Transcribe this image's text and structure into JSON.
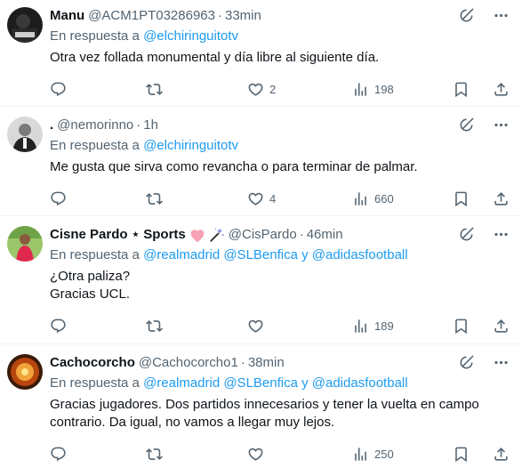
{
  "tweets": [
    {
      "name": "Manu",
      "handle": "@ACM1PT03286963",
      "time": "33min",
      "reply_prefix": "En respuesta a",
      "reply_to": "@elchiringuitotv",
      "text_lines": [
        "Otra vez follada monumental y día libre al siguiente día."
      ],
      "replies": "",
      "retweets": "",
      "likes": "2",
      "views": "198"
    },
    {
      "name": ".",
      "handle": "@nemorinno",
      "time": "1h",
      "reply_prefix": "En respuesta a",
      "reply_to": "@elchiringuitotv",
      "text_lines": [
        "Me gusta que sirva como revancha o para terminar de palmar."
      ],
      "replies": "",
      "retweets": "",
      "likes": "4",
      "views": "660"
    },
    {
      "name": "Cisne Pardo ⋆ Sports",
      "handle": "@CisPardo",
      "time": "46min",
      "reply_prefix": "En respuesta a",
      "reply_to": "@realmadrid @SLBenfica y @adidasfootball",
      "text_lines": [
        "¿Otra paliza?",
        "Gracias UCL."
      ],
      "replies": "",
      "retweets": "",
      "likes": "",
      "views": "189"
    },
    {
      "name": "Cachocorcho",
      "handle": "@Cachocorcho1",
      "time": "38min",
      "reply_prefix": "En respuesta a",
      "reply_to": "@realmadrid @SLBenfica y @adidasfootball",
      "text_lines": [
        "Gracias jugadores. Dos partidos innecesarios y tener la vuelta en campo",
        "contrario. Da igual, no vamos a llegar muy lejos."
      ],
      "replies": "",
      "retweets": "",
      "likes": "",
      "views": "250"
    }
  ],
  "colors": {
    "link": "#1d9bf0",
    "secondary": "#536471",
    "primary": "#0f1419",
    "divider": "#eff3f4"
  },
  "icons": [
    "grok-icon",
    "more-icon",
    "reply-icon",
    "retweet-icon",
    "like-icon",
    "views-icon",
    "bookmark-icon",
    "share-icon"
  ]
}
